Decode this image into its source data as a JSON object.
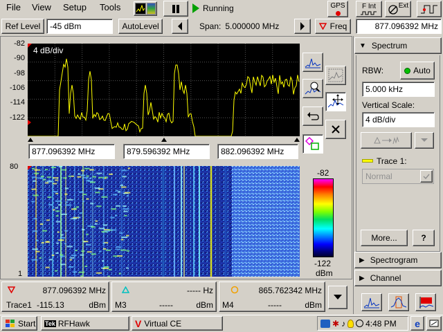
{
  "menu": {
    "file": "File",
    "view": "View",
    "setup": "Setup",
    "tools": "Tools"
  },
  "status": {
    "running": "Running"
  },
  "toolbar": {
    "gps": "GPS",
    "fint": "F Int",
    "ext": "Ext"
  },
  "controls": {
    "ref_level_label": "Ref Level",
    "ref_level_value": "-45 dBm",
    "autolevel": "AutoLevel",
    "span_label": "Span:",
    "span_value": "5.000000 MHz",
    "freq_label": "Freq",
    "freq_value": "877.096392 MHz"
  },
  "spectrum": {
    "scale_label": "4 dB/div",
    "y_ticks": [
      "-82",
      "-90",
      "-98",
      "-106",
      "-114",
      "-122"
    ],
    "freq_markers": [
      "877.096392 MHz",
      "879.596392 MHz",
      "882.096392 MHz"
    ]
  },
  "spectrogram": {
    "y_top": "80",
    "y_bottom": "1",
    "colorbar_max": "-82",
    "colorbar_min": "-122",
    "colorbar_unit": "dBm"
  },
  "readouts": [
    {
      "freq": "877.096392 MHz",
      "name": "Trace1",
      "value": "-115.13",
      "unit": "dBm"
    },
    {
      "freq": "----- Hz",
      "name": "M3",
      "value": "-----",
      "unit": "dBm"
    },
    {
      "freq": "865.762342 MHz",
      "name": "M4",
      "value": "-----",
      "unit": "dBm"
    }
  ],
  "panel": {
    "spectrum_title": "Spectrum",
    "rbw_label": "RBW:",
    "auto_label": "Auto",
    "rbw_value": "5.000 kHz",
    "vscale_label": "Vertical Scale:",
    "vscale_value": "4 dB/div",
    "trace_label": "Trace 1:",
    "trace_mode": "Normal",
    "more_label": "More...",
    "help_label": "?",
    "spectrogram_title": "Spectrogram",
    "channel_title": "Channel"
  },
  "taskbar": {
    "start": "Start",
    "app1": "RFHawk",
    "app2": "Virtual CE",
    "time": "4:48 PM"
  },
  "colors": {
    "trace": "#ffff00",
    "plot_bg": "#000000",
    "spectrogram_bg": "#0a1060",
    "highlight": "#0a246a"
  }
}
